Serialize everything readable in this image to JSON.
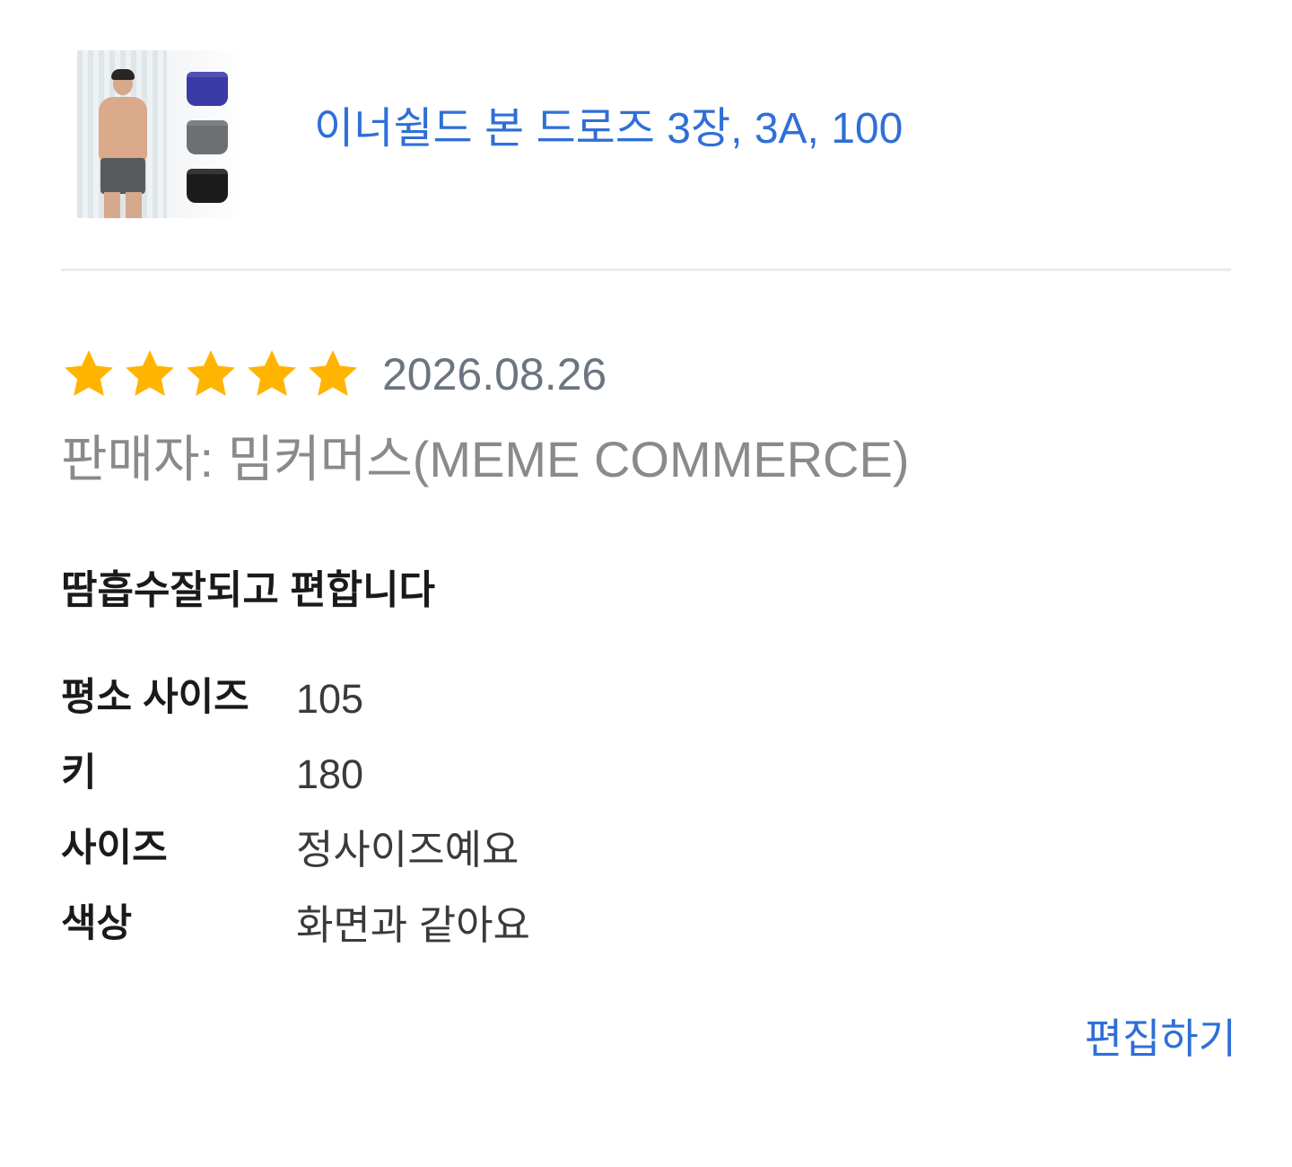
{
  "product": {
    "image_alt": "product-thumbnail",
    "title": "이너쉴드 본 드로즈 3장, 3A, 100"
  },
  "review": {
    "rating": 5,
    "max_rating": 5,
    "date": "2026.08.26",
    "seller": "판매자: 밈커머스(MEME COMMERCE)",
    "headline": "땀흡수잘되고 편합니다",
    "attributes": [
      {
        "label": "평소 사이즈",
        "value": "105"
      },
      {
        "label": "키",
        "value": "180"
      },
      {
        "label": "사이즈",
        "value": "정사이즈예요"
      },
      {
        "label": "색상",
        "value": "화면과 같아요"
      }
    ]
  },
  "actions": {
    "edit_label": "편집하기"
  },
  "colors": {
    "accent": "#2f6fd6",
    "star": "#ffb400",
    "date": "#6b7480",
    "muted": "#8a8a8a",
    "text": "#1a1a1a"
  }
}
